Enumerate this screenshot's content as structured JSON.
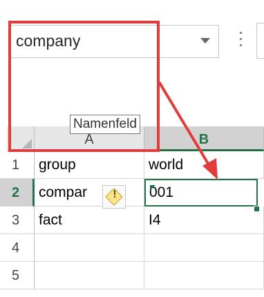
{
  "name_box": {
    "value": "company",
    "tooltip": "Namenfeld"
  },
  "columns": [
    {
      "label": "A",
      "selected": false
    },
    {
      "label": "B",
      "selected": true
    }
  ],
  "rows": [
    {
      "label": "1",
      "selected": false,
      "cells": [
        "group",
        "world"
      ]
    },
    {
      "label": "2",
      "selected": true,
      "cells": [
        "compar",
        "001"
      ]
    },
    {
      "label": "3",
      "selected": false,
      "cells": [
        "fact",
        "I4"
      ]
    },
    {
      "label": "4",
      "selected": false,
      "cells": [
        "",
        ""
      ]
    },
    {
      "label": "5",
      "selected": false,
      "cells": [
        "",
        ""
      ]
    }
  ],
  "active_cell": "B2",
  "icons": {
    "name_box_dropdown": "chevron-down-icon",
    "formula_options": "vertical-dots-icon",
    "error_indicator": "warning-diamond-icon",
    "select_all": "select-all-triangle-icon"
  },
  "colors": {
    "excel_green": "#217346",
    "annotation_red": "#e03c3c",
    "warning_yellow": "#fbe38c"
  }
}
